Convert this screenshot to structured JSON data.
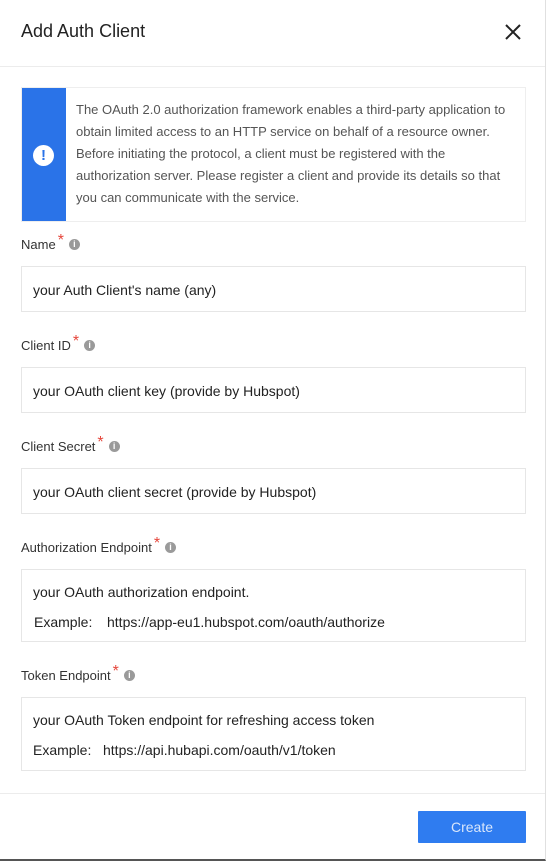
{
  "dialog": {
    "title": "Add Auth Client",
    "close_icon": "close-icon"
  },
  "notice": {
    "icon": "exclamation-icon",
    "text": "The OAuth 2.0 authorization framework enables a third-party application to obtain limited access to an HTTP service on behalf of a resource owner. Before initiating the protocol, a client must be registered with the authorization server. Please register a client and provide its details so that you can communicate with the service."
  },
  "fields": {
    "name": {
      "label": "Name",
      "required": "*",
      "placeholder": "your Auth Client's name (any)"
    },
    "client_id": {
      "label": "Client ID",
      "required": "*",
      "placeholder": "your OAuth client key (provide by Hubspot)"
    },
    "client_secret": {
      "label": "Client Secret",
      "required": "*",
      "placeholder": "your OAuth client secret (provide by Hubspot)"
    },
    "authorization_endpoint": {
      "label": "Authorization Endpoint",
      "required": "*",
      "placeholder": "your OAuth authorization endpoint.",
      "example_label": "Example:",
      "example_value": "https://app-eu1.hubspot.com/oauth/authorize"
    },
    "token_endpoint": {
      "label": "Token Endpoint",
      "required": "*",
      "placeholder": "your OAuth Token endpoint for refreshing access token",
      "example_label": "Example:",
      "example_value": "https://api.hubapi.com/oauth/v1/token"
    }
  },
  "info_icon": "i",
  "footer": {
    "create_label": "Create"
  },
  "colors": {
    "accent": "#2a73e8",
    "required": "#e5453a",
    "button": "#2f7cf0"
  }
}
